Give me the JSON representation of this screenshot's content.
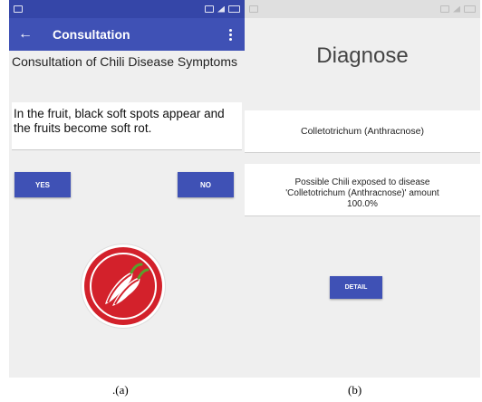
{
  "screen_a": {
    "appbar_title": "Consultation",
    "heading": "Consultation of Chili Disease Symptoms",
    "question": "In the fruit, black soft spots appear and the fruits become soft rot.",
    "yes_label": "YES",
    "no_label": "NO",
    "caption": ".(a)"
  },
  "screen_b": {
    "heading": "Diagnose",
    "disease_name": "Colletotrichum (Anthracnose)",
    "probability_line1": "Possible Chili exposed to disease",
    "probability_line2": "'Colletotrichum (Anthracnose)' amount",
    "probability_line3": "100.0%",
    "detail_label": "DETAIL",
    "caption": "(b)"
  },
  "colors": {
    "primary": "#3f51b5",
    "statusbar_dark": "#3546a8",
    "logo_red": "#d3212b"
  },
  "icons": [
    "back-arrow-icon",
    "overflow-menu-icon",
    "chili-logo-icon"
  ]
}
